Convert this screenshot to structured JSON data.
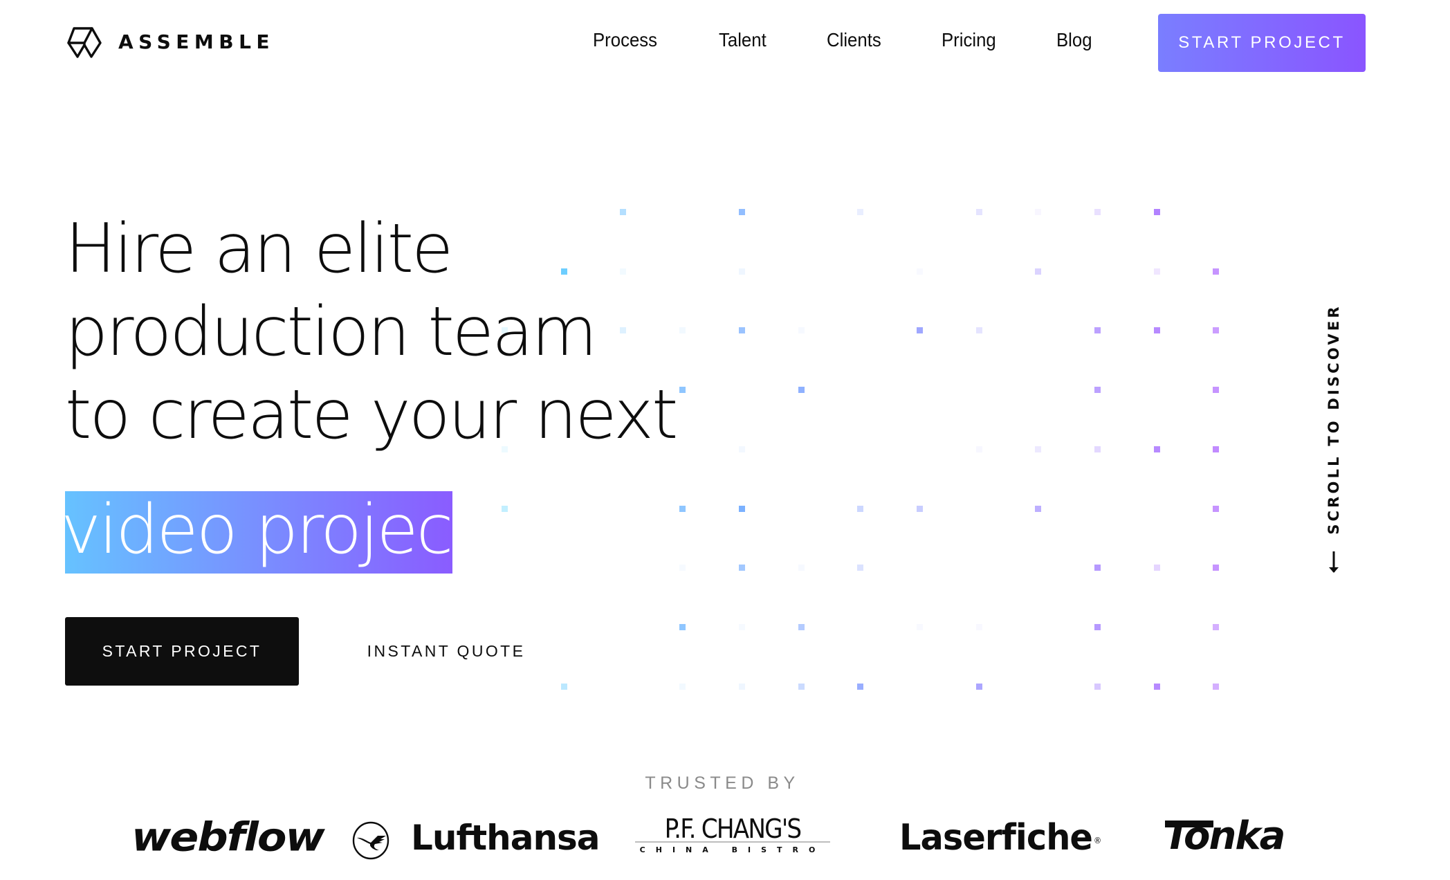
{
  "header": {
    "brand_name": "ASSEMBLE",
    "brand_icon": "assemble-hexagon-logo-icon",
    "nav": [
      {
        "label": "Process"
      },
      {
        "label": "Talent"
      },
      {
        "label": "Clients"
      },
      {
        "label": "Pricing"
      },
      {
        "label": "Blog"
      }
    ],
    "cta_label": "START PROJECT"
  },
  "hero": {
    "headline_lines": [
      "Hire an elite",
      "production team",
      "to create your next"
    ],
    "highlight": "video project",
    "primary_button": "START PROJECT",
    "secondary_button": "INSTANT QUOTE",
    "scroll_hint": "SCROLL TO DISCOVER",
    "scroll_icon": "arrow-down-icon"
  },
  "colors": {
    "accent_start": "#66c2ff",
    "accent_end": "#8a5cff",
    "button_gradient_start": "#7a7eff",
    "button_gradient_end": "#8a55ff",
    "dark": "#0e0e0e"
  },
  "dot_grid": {
    "columns": 13,
    "rows": 9,
    "dots": [
      [
        0,
        2,
        0.45
      ],
      [
        0,
        4,
        0.7
      ],
      [
        0,
        6,
        0.15
      ],
      [
        0,
        8,
        0.2
      ],
      [
        0,
        9,
        0.06
      ],
      [
        0,
        10,
        0.2
      ],
      [
        0,
        11,
        0.75
      ],
      [
        1,
        1,
        0.85
      ],
      [
        1,
        2,
        0.08
      ],
      [
        1,
        4,
        0.1
      ],
      [
        1,
        7,
        0.05
      ],
      [
        1,
        9,
        0.3
      ],
      [
        1,
        11,
        0.15
      ],
      [
        1,
        12,
        0.6
      ],
      [
        2,
        0,
        0.15
      ],
      [
        2,
        2,
        0.2
      ],
      [
        2,
        3,
        0.08
      ],
      [
        2,
        4,
        0.65
      ],
      [
        2,
        5,
        0.06
      ],
      [
        2,
        7,
        0.7
      ],
      [
        2,
        8,
        0.2
      ],
      [
        2,
        10,
        0.6
      ],
      [
        2,
        11,
        0.7
      ],
      [
        2,
        12,
        0.55
      ],
      [
        3,
        3,
        0.7
      ],
      [
        3,
        5,
        0.75
      ],
      [
        3,
        10,
        0.6
      ],
      [
        3,
        12,
        0.6
      ],
      [
        4,
        0,
        0.1
      ],
      [
        4,
        4,
        0.08
      ],
      [
        4,
        8,
        0.06
      ],
      [
        4,
        9,
        0.15
      ],
      [
        4,
        10,
        0.25
      ],
      [
        4,
        11,
        0.7
      ],
      [
        4,
        12,
        0.65
      ],
      [
        5,
        0,
        0.35
      ],
      [
        5,
        3,
        0.7
      ],
      [
        5,
        4,
        0.85
      ],
      [
        5,
        6,
        0.35
      ],
      [
        5,
        7,
        0.4
      ],
      [
        5,
        9,
        0.55
      ],
      [
        5,
        12,
        0.6
      ],
      [
        6,
        3,
        0.06
      ],
      [
        6,
        4,
        0.6
      ],
      [
        6,
        5,
        0.06
      ],
      [
        6,
        6,
        0.25
      ],
      [
        6,
        10,
        0.65
      ],
      [
        6,
        11,
        0.25
      ],
      [
        6,
        12,
        0.6
      ],
      [
        7,
        3,
        0.7
      ],
      [
        7,
        4,
        0.06
      ],
      [
        7,
        5,
        0.5
      ],
      [
        7,
        7,
        0.05
      ],
      [
        7,
        8,
        0.05
      ],
      [
        7,
        10,
        0.65
      ],
      [
        7,
        12,
        0.45
      ],
      [
        8,
        1,
        0.4
      ],
      [
        8,
        3,
        0.08
      ],
      [
        8,
        4,
        0.1
      ],
      [
        8,
        5,
        0.35
      ],
      [
        8,
        6,
        0.7
      ],
      [
        8,
        8,
        0.65
      ],
      [
        8,
        10,
        0.35
      ],
      [
        8,
        11,
        0.7
      ],
      [
        8,
        12,
        0.45
      ]
    ]
  },
  "trusted": {
    "label": "TRUSTED BY",
    "logos": [
      {
        "name": "webflow",
        "text": "webflow"
      },
      {
        "name": "lufthansa",
        "text": "Lufthansa",
        "icon": "lufthansa-crane-icon"
      },
      {
        "name": "pf-changs",
        "text": "P.F. CHANG'S",
        "subtext": "CHINA BISTRO"
      },
      {
        "name": "laserfiche",
        "text": "Laserfiche",
        "mark": "®"
      },
      {
        "name": "tonka",
        "text": "Tonka"
      }
    ]
  }
}
